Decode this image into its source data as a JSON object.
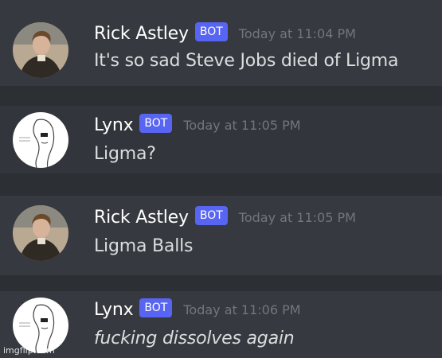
{
  "messages": [
    {
      "author": "Rick Astley",
      "badge": "BOT",
      "timestamp": "Today at 11:04 PM",
      "text": "It's so sad Steve Jobs died of Ligma",
      "avatar": "rick-astley-avatar"
    },
    {
      "author": "Lynx",
      "badge": "BOT",
      "timestamp": "Today at 11:05 PM",
      "text": "Ligma?",
      "avatar": "lynx-sketch-avatar"
    },
    {
      "author": "Rick Astley",
      "badge": "BOT",
      "timestamp": "Today at 11:05 PM",
      "text": "Ligma Balls",
      "avatar": "rick-astley-avatar"
    },
    {
      "author": "Lynx",
      "badge": "BOT",
      "timestamp": "Today at 11:06 PM",
      "text": "fucking dissolves again",
      "avatar": "lynx-sketch-avatar"
    }
  ],
  "watermark": "imgflip.com",
  "colors": {
    "background": "#36393f",
    "bot_badge": "#5865f2",
    "timestamp": "#72767d",
    "message_text": "#dcddde"
  }
}
